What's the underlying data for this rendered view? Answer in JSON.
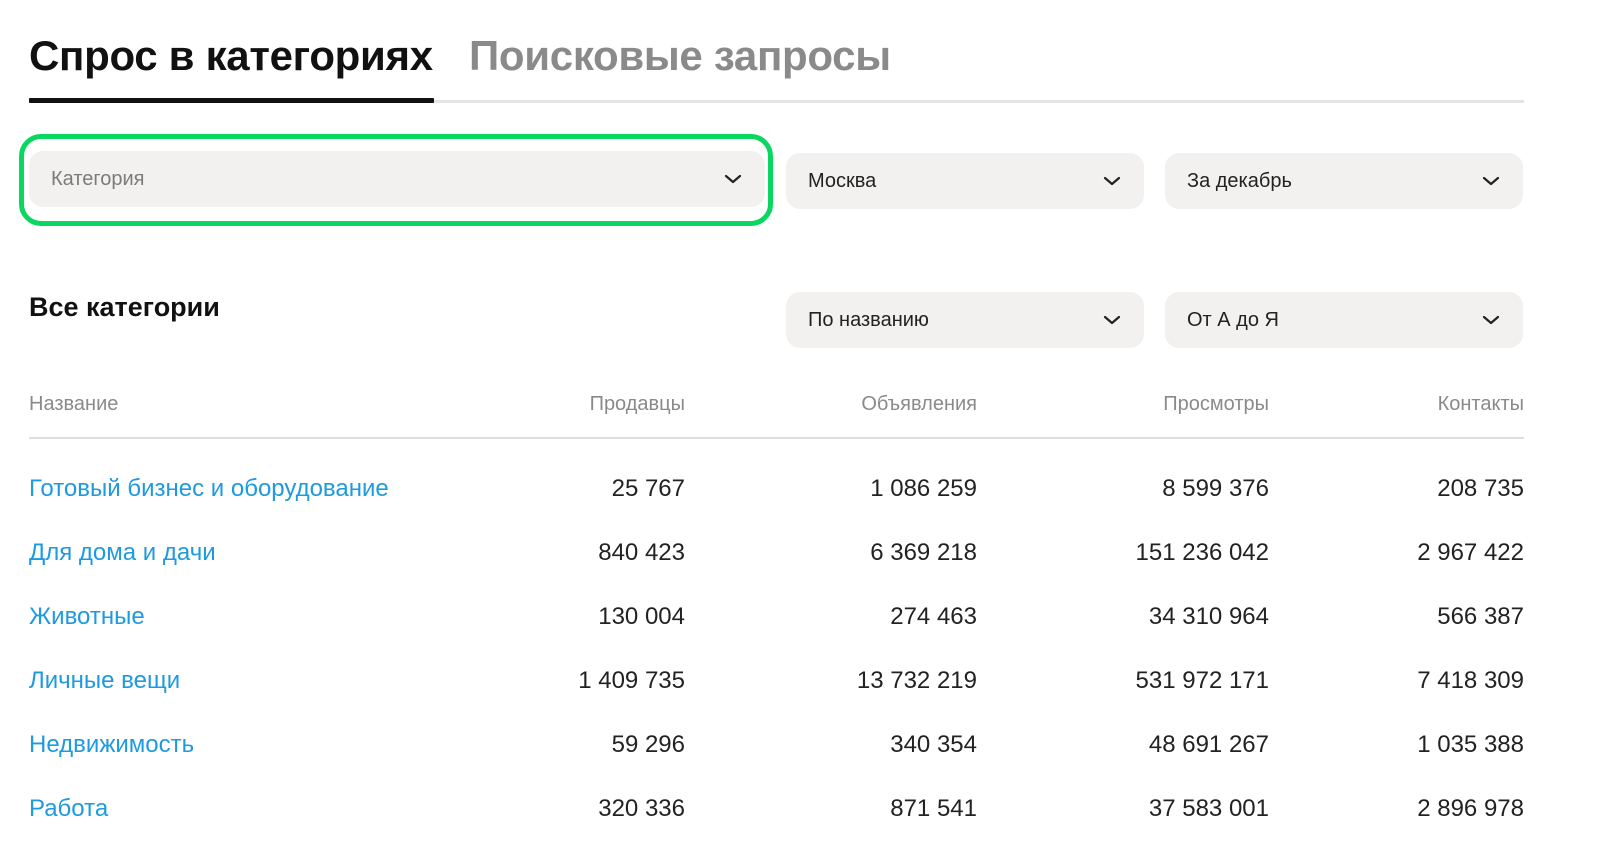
{
  "tabs": [
    {
      "label": "Спрос в категориях",
      "active": true
    },
    {
      "label": "Поисковые запросы",
      "active": false
    }
  ],
  "filters": {
    "category": {
      "placeholder": "Категория",
      "icon": "chevron-down-icon"
    },
    "city": {
      "value": "Москва",
      "icon": "chevron-down-icon"
    },
    "period": {
      "value": "За декабрь",
      "icon": "chevron-down-icon"
    }
  },
  "section": {
    "title": "Все категории",
    "sort_by": "По названию",
    "sort_order": "От А до Я"
  },
  "table": {
    "headers": [
      "Название",
      "Продавцы",
      "Объявления",
      "Просмотры",
      "Контакты"
    ],
    "rows": [
      {
        "name": "Готовый бизнес и оборудование",
        "sellers": "25 767",
        "ads": "1 086 259",
        "views": "8 599 376",
        "contacts": "208 735"
      },
      {
        "name": "Для дома и дачи",
        "sellers": "840 423",
        "ads": "6 369 218",
        "views": "151 236 042",
        "contacts": "2 967 422"
      },
      {
        "name": "Животные",
        "sellers": "130 004",
        "ads": "274 463",
        "views": "34 310 964",
        "contacts": "566 387"
      },
      {
        "name": "Личные вещи",
        "sellers": "1 409 735",
        "ads": "13 732 219",
        "views": "531 972 171",
        "contacts": "7 418 309"
      },
      {
        "name": "Недвижимость",
        "sellers": "59 296",
        "ads": "340 354",
        "views": "48 691 267",
        "contacts": "1 035 388"
      },
      {
        "name": "Работа",
        "sellers": "320 336",
        "ads": "871 541",
        "views": "37 583 001",
        "contacts": "2 896 978"
      }
    ]
  },
  "colors": {
    "link": "#1e9ae0",
    "focus_ring": "#0ad760",
    "select_bg": "#f2f1f0"
  }
}
